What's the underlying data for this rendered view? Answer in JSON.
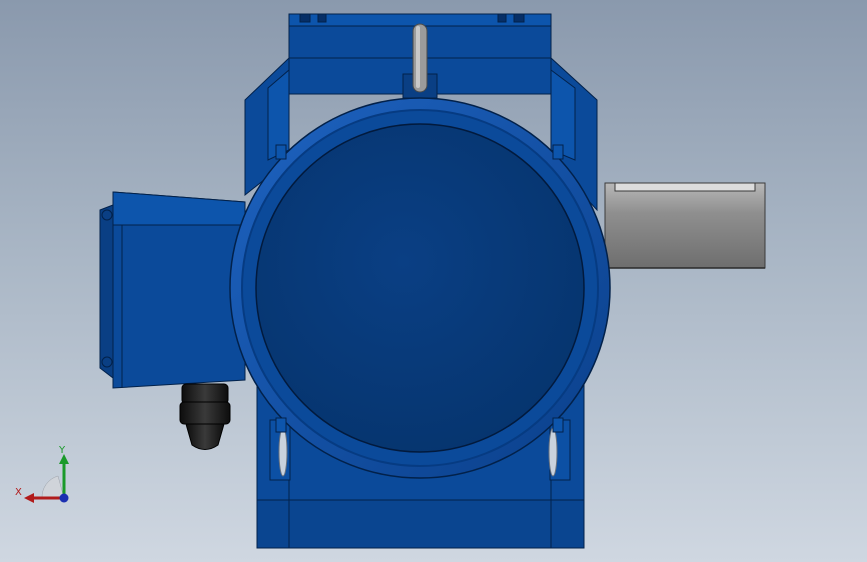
{
  "scene": {
    "subject": "motor-gearbox-assembly",
    "background_top": "#8a99ad",
    "background_bottom": "#cfd7e1",
    "body_color": "#0b4a9a",
    "body_dark": "#063b82",
    "shaft_color": "#8c8c8c",
    "gland_color": "#1a1a1a"
  },
  "triad": {
    "x_label": "X",
    "y_label": "Y",
    "x_color": "#b11b1b",
    "y_color": "#1a9a2a",
    "z_color": "#1b2fb1"
  }
}
